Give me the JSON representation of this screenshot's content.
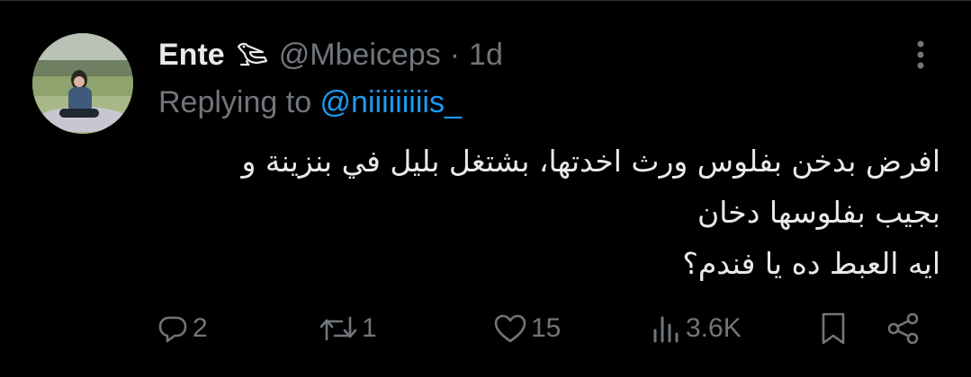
{
  "tweet": {
    "author_name": "Ente",
    "author_handle": "@Mbeiceps",
    "separator": "·",
    "time": "1d",
    "replying_prefix": "Replying to ",
    "replying_to": "@niiiiiiiiis_",
    "text_lines": [
      "افرض بدخن بفلوس ورث اخدتها، بشتغل بليل في بنزينة و",
      "بجيب بفلوسها دخان",
      "ايه العبط ده يا فندم؟"
    ]
  },
  "actions": {
    "replies": "2",
    "reposts": "1",
    "likes": "15",
    "views": "3.6K"
  },
  "icons": {
    "badge": "pelican-emoji-icon",
    "more": "more-vertical-icon",
    "reply": "reply-bubble-icon",
    "repost": "repost-arrows-icon",
    "like": "heart-icon",
    "views": "bar-chart-icon",
    "bookmark": "bookmark-icon",
    "share": "share-icon"
  },
  "colors": {
    "background": "#000000",
    "primary_text": "#e7e9ea",
    "secondary_text": "#71767b",
    "accent": "#1d9bf0"
  }
}
